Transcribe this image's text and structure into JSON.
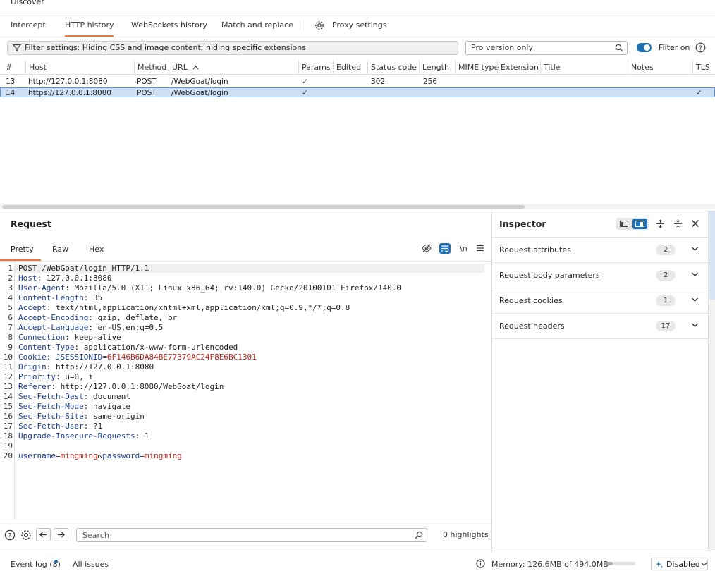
{
  "top": {
    "partial_label": "Discover"
  },
  "tabs": [
    {
      "label": "Intercept"
    },
    {
      "label": "HTTP history"
    },
    {
      "label": "WebSockets history"
    },
    {
      "label": "Match and replace"
    },
    {
      "label": "Proxy settings"
    }
  ],
  "filter": {
    "text": "Filter settings: Hiding CSS and image content; hiding specific extensions",
    "search_value": "Pro version only",
    "toggle_label": "Filter on",
    "toggle_on": true
  },
  "table": {
    "headers": [
      "#",
      "Host",
      "Method",
      "URL",
      "Params",
      "Edited",
      "Status code",
      "Length",
      "MIME type",
      "Extension",
      "Title",
      "Notes",
      "TLS"
    ],
    "sort_arrow": "^",
    "rows": [
      {
        "num": "13",
        "host": "http://127.0.0.1:8080",
        "method": "POST",
        "url": "/WebGoat/login",
        "params": "✓",
        "status": "302",
        "length": "256",
        "tls": ""
      },
      {
        "num": "14",
        "host": "https://127.0.0.1:8080",
        "method": "POST",
        "url": "/WebGoat/login",
        "params": "✓",
        "status": "",
        "length": "",
        "tls": "✓"
      }
    ]
  },
  "request": {
    "title": "Request",
    "tabs": [
      "Pretty",
      "Raw",
      "Hex"
    ],
    "newline_label": "\\n",
    "lines": [
      {
        "n": "1",
        "parts": [
          [
            "POST /WebGoat/login HTTP/1.1",
            "v"
          ]
        ]
      },
      {
        "n": "2",
        "parts": [
          [
            "Host",
            "k"
          ],
          [
            ": 127.0.0.1:8080",
            "v"
          ]
        ]
      },
      {
        "n": "3",
        "parts": [
          [
            "User-Agent",
            "k"
          ],
          [
            ": Mozilla/5.0 (X11; Linux x86_64; rv:140.0) Gecko/20100101 Firefox/140.0",
            "v"
          ]
        ]
      },
      {
        "n": "4",
        "parts": [
          [
            "Content-Length",
            "k"
          ],
          [
            ": 35",
            "v"
          ]
        ]
      },
      {
        "n": "5",
        "parts": [
          [
            "Accept",
            "k"
          ],
          [
            ": text/html,application/xhtml+xml,application/xml;q=0.9,*/*;q=0.8",
            "v"
          ]
        ]
      },
      {
        "n": "6",
        "parts": [
          [
            "Accept-Encoding",
            "k"
          ],
          [
            ": gzip, deflate, br",
            "v"
          ]
        ]
      },
      {
        "n": "7",
        "parts": [
          [
            "Accept-Language",
            "k"
          ],
          [
            ": en-US,en;q=0.5",
            "v"
          ]
        ]
      },
      {
        "n": "8",
        "parts": [
          [
            "Connection",
            "k"
          ],
          [
            ": keep-alive",
            "v"
          ]
        ]
      },
      {
        "n": "9",
        "parts": [
          [
            "Content-Type",
            "k"
          ],
          [
            ": application/x-www-form-urlencoded",
            "v"
          ]
        ]
      },
      {
        "n": "10",
        "parts": [
          [
            "Cookie",
            "k"
          ],
          [
            ": ",
            "v"
          ],
          [
            "JSESSIONID",
            "k"
          ],
          [
            "=",
            "v"
          ],
          [
            "6F146B6DA84BE77379AC24F8E6BC1301",
            "r"
          ]
        ]
      },
      {
        "n": "11",
        "parts": [
          [
            "Origin",
            "k"
          ],
          [
            ": http://127.0.0.1:8080",
            "v"
          ]
        ]
      },
      {
        "n": "12",
        "parts": [
          [
            "Priority",
            "k"
          ],
          [
            ": u=0, i",
            "v"
          ]
        ]
      },
      {
        "n": "13",
        "parts": [
          [
            "Referer",
            "k"
          ],
          [
            ": http://127.0.0.1:8080/WebGoat/login",
            "v"
          ]
        ]
      },
      {
        "n": "14",
        "parts": [
          [
            "Sec-Fetch-Dest",
            "k"
          ],
          [
            ": document",
            "v"
          ]
        ]
      },
      {
        "n": "15",
        "parts": [
          [
            "Sec-Fetch-Mode",
            "k"
          ],
          [
            ": navigate",
            "v"
          ]
        ]
      },
      {
        "n": "16",
        "parts": [
          [
            "Sec-Fetch-Site",
            "k"
          ],
          [
            ": same-origin",
            "v"
          ]
        ]
      },
      {
        "n": "17",
        "parts": [
          [
            "Sec-Fetch-User",
            "k"
          ],
          [
            ": ?1",
            "v"
          ]
        ]
      },
      {
        "n": "18",
        "parts": [
          [
            "Upgrade-Insecure-Requests",
            "k"
          ],
          [
            ": 1",
            "v"
          ]
        ]
      },
      {
        "n": "19",
        "parts": []
      },
      {
        "n": "20",
        "parts": [
          [
            "username",
            "k"
          ],
          [
            "=",
            "v"
          ],
          [
            "mingming",
            "r"
          ],
          [
            "&",
            "v"
          ],
          [
            "password",
            "k"
          ],
          [
            "=",
            "v"
          ],
          [
            "mingming",
            "r"
          ]
        ]
      }
    ],
    "search_placeholder": "Search",
    "highlights": "0 highlights"
  },
  "inspector": {
    "title": "Inspector",
    "sections": [
      {
        "label": "Request attributes",
        "count": "2"
      },
      {
        "label": "Request body parameters",
        "count": "2"
      },
      {
        "label": "Request cookies",
        "count": "1"
      },
      {
        "label": "Request headers",
        "count": "17"
      }
    ]
  },
  "footer": {
    "event_log": "Event log (8)",
    "all_issues": "All issues",
    "memory": "Memory: 126.6MB of 494.0MB",
    "memory_fraction": 0.256,
    "ai_status": "Disabled"
  },
  "colors": {
    "accent": "#e8783c",
    "toggle": "#1f6fb5",
    "selected_row": "#cfe0f5",
    "header_name": "#1d3f8f",
    "value_red": "#b3261e"
  }
}
